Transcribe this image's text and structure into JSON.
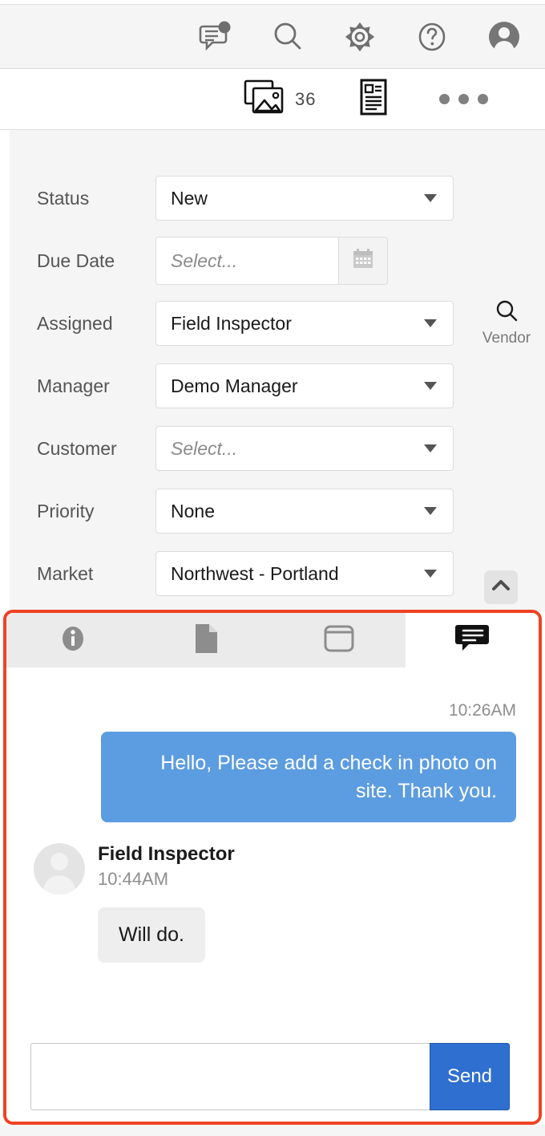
{
  "header": {
    "icons": [
      {
        "name": "messages-icon",
        "label": "Messages",
        "badge": true
      },
      {
        "name": "search-icon",
        "label": "Search"
      },
      {
        "name": "gear-icon",
        "label": "Settings"
      },
      {
        "name": "help-icon",
        "label": "Help"
      },
      {
        "name": "user-avatar-icon",
        "label": "Account"
      }
    ]
  },
  "toolbar": {
    "photos_label": "Photos",
    "photo_count": "36",
    "report_label": "Report",
    "more_label": "More options"
  },
  "form": {
    "fields": [
      {
        "label": "Status",
        "type": "select",
        "value": "New",
        "placeholder": "Select...",
        "is_placeholder": false
      },
      {
        "label": "Due Date",
        "type": "date",
        "value": "",
        "placeholder": "Select...",
        "is_placeholder": true
      },
      {
        "label": "Assigned",
        "type": "select",
        "value": "Field Inspector",
        "placeholder": "Select...",
        "is_placeholder": false
      },
      {
        "label": "Manager",
        "type": "select",
        "value": "Demo Manager",
        "placeholder": "Select...",
        "is_placeholder": false
      },
      {
        "label": "Customer",
        "type": "select",
        "value": "Select...",
        "placeholder": "Select...",
        "is_placeholder": true
      },
      {
        "label": "Priority",
        "type": "select",
        "value": "None",
        "placeholder": "Select...",
        "is_placeholder": false
      },
      {
        "label": "Market",
        "type": "select",
        "value": "Northwest - Portland",
        "placeholder": "Select...",
        "is_placeholder": false
      }
    ],
    "vendor_search_label": "Vendor",
    "collapse_label": "Collapse"
  },
  "chat": {
    "tabs": [
      {
        "name": "tab-info",
        "icon": "info-icon",
        "label": "Info",
        "active": false
      },
      {
        "name": "tab-document",
        "icon": "document-icon",
        "label": "Document",
        "active": false
      },
      {
        "name": "tab-window",
        "icon": "window-icon",
        "label": "Window",
        "active": false
      },
      {
        "name": "tab-chat",
        "icon": "chat-icon",
        "label": "Chat",
        "active": true
      }
    ],
    "outgoing": {
      "time": "10:26AM",
      "text": "Hello, Please add a check in photo on site. Thank you."
    },
    "incoming": {
      "sender": "Field Inspector",
      "time": "10:44AM",
      "text": "Will do."
    },
    "composer": {
      "value": "",
      "placeholder": "",
      "send_label": "Send"
    }
  },
  "colors": {
    "accent_red": "#ef4323",
    "bubble_blue": "#5c9ce0",
    "send_blue": "#2f6fd0",
    "panel_gray": "#f5f5f5",
    "tab_gray": "#ebebeb"
  }
}
